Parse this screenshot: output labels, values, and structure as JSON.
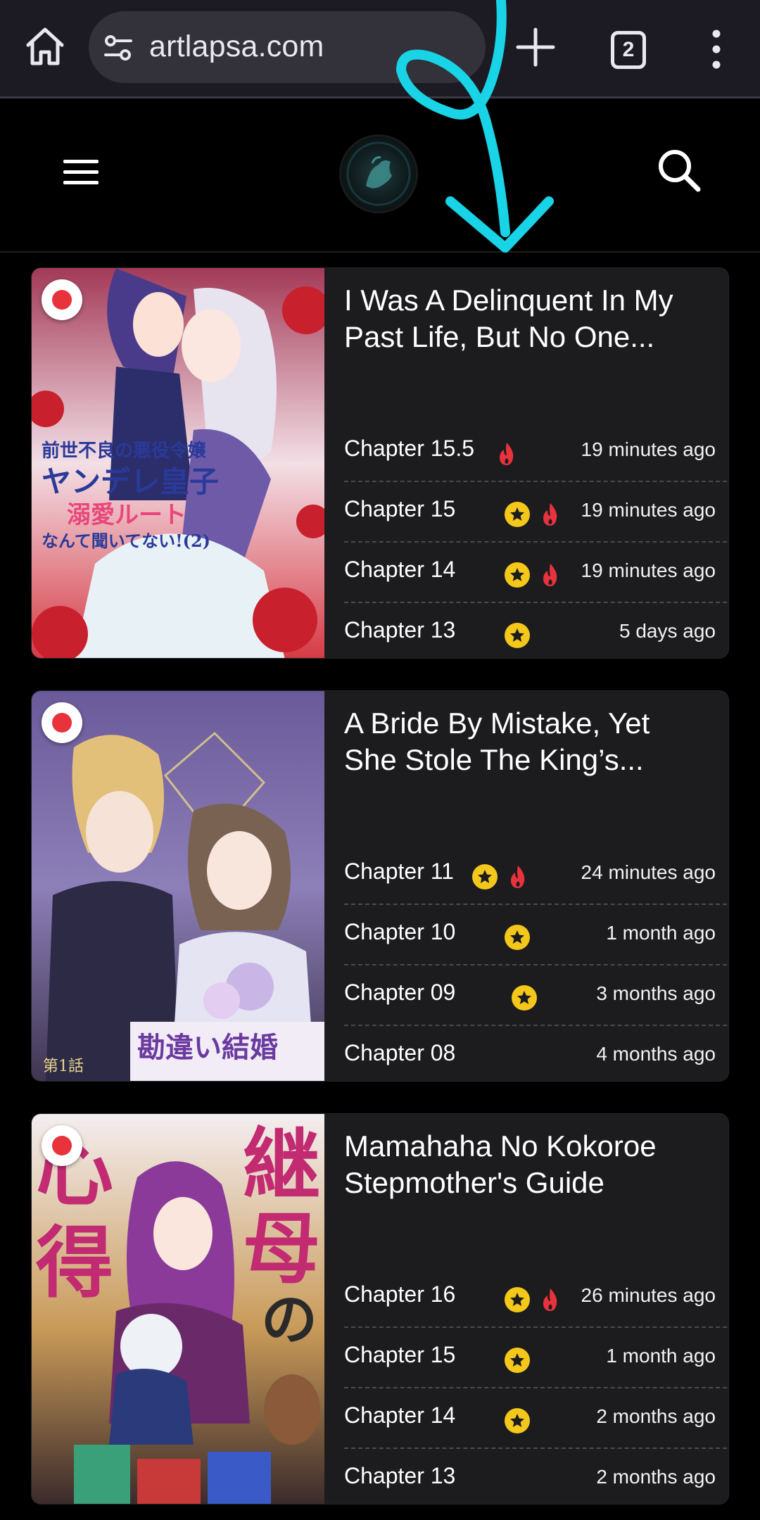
{
  "browser": {
    "url": "artlapsa.com",
    "tab_count": "2"
  },
  "site": {
    "logo_name": "site-logo"
  },
  "colors": {
    "star": "#f4c71b",
    "fire": "#e8323c",
    "card_bg": "#1c1c1f"
  },
  "cards": [
    {
      "title": "I Was A Delinquent In My Past Life, But No One...",
      "chapters": [
        {
          "name": "Chapter 15.5",
          "time": "19 minutes ago",
          "star": false,
          "fire": true
        },
        {
          "name": "Chapter 15",
          "time": "19 minutes ago",
          "star": true,
          "fire": true
        },
        {
          "name": "Chapter 14",
          "time": "19 minutes ago",
          "star": true,
          "fire": true
        },
        {
          "name": "Chapter 13",
          "time": "5 days ago",
          "star": true,
          "fire": false
        }
      ]
    },
    {
      "title": "A Bride By Mistake, Yet She Stole The King’s...",
      "chapters": [
        {
          "name": "Chapter 11",
          "time": "24 minutes ago",
          "star": true,
          "fire": true
        },
        {
          "name": "Chapter 10",
          "time": "1 month ago",
          "star": true,
          "fire": false
        },
        {
          "name": "Chapter 09",
          "time": "3 months ago",
          "star": true,
          "fire": false
        },
        {
          "name": "Chapter 08",
          "time": "4 months ago",
          "star": false,
          "fire": false
        }
      ]
    },
    {
      "title": "Mamahaha No Kokoroe Stepmother's Guide",
      "chapters": [
        {
          "name": "Chapter 16",
          "time": "26 minutes ago",
          "star": true,
          "fire": true
        },
        {
          "name": "Chapter 15",
          "time": "1 month ago",
          "star": true,
          "fire": false
        },
        {
          "name": "Chapter 14",
          "time": "2 months ago",
          "star": true,
          "fire": false
        },
        {
          "name": "Chapter 13",
          "time": "2 months ago",
          "star": false,
          "fire": false
        }
      ]
    }
  ]
}
